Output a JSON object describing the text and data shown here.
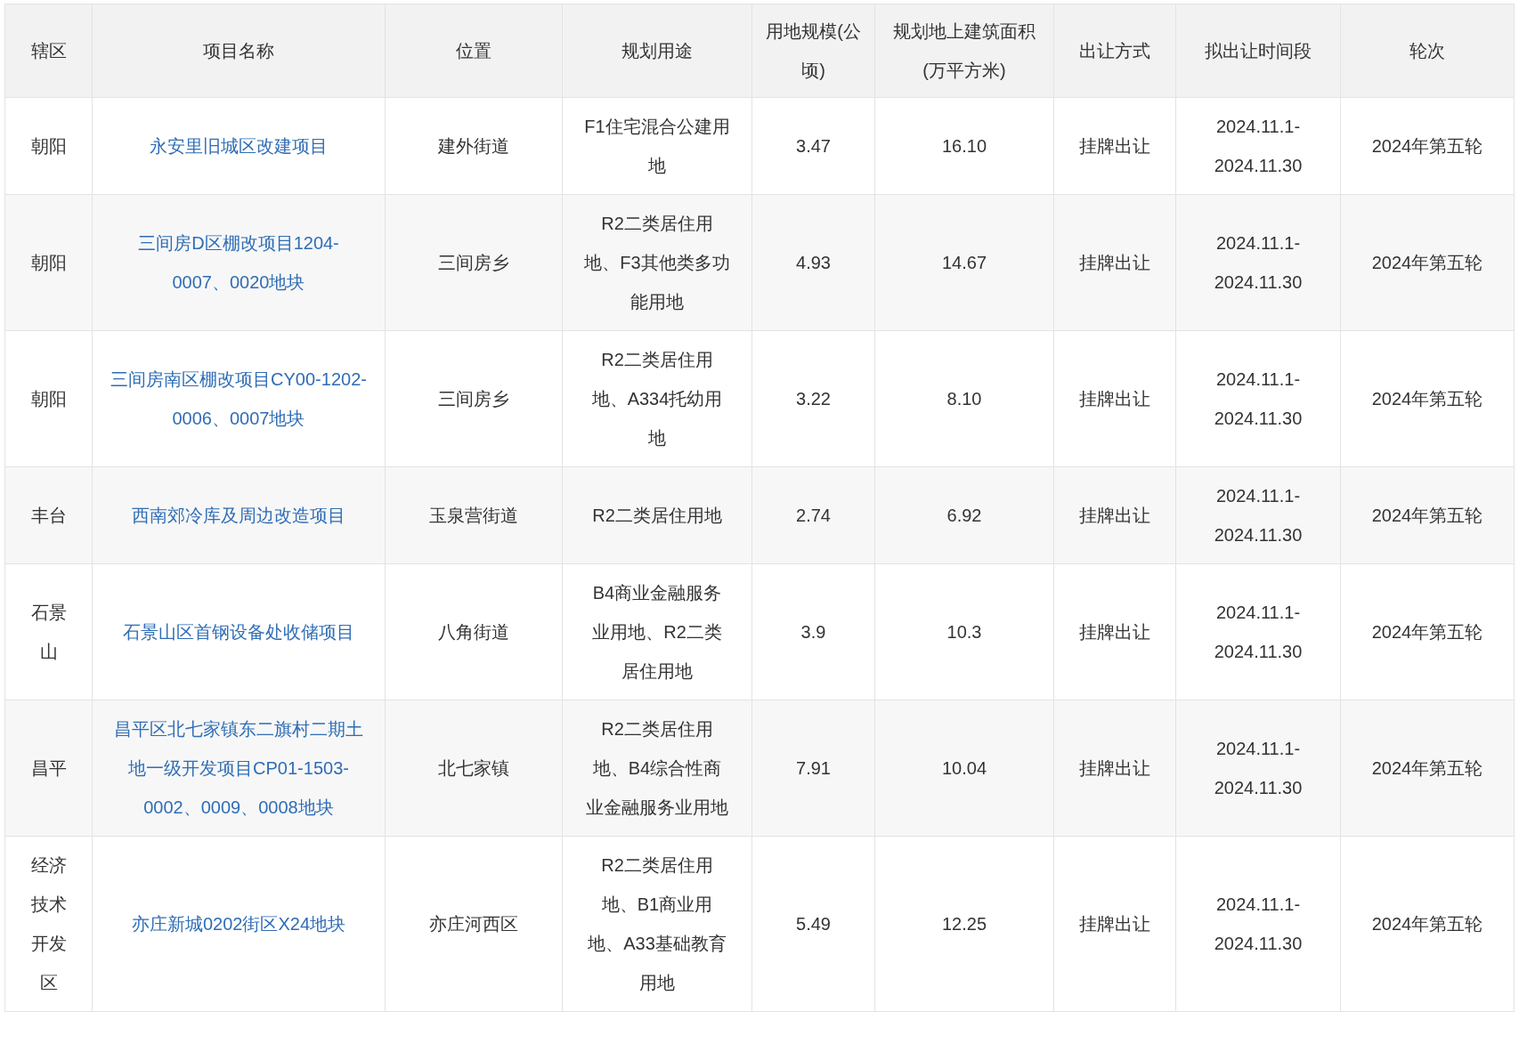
{
  "table": {
    "columns": [
      "辖区",
      "项目名称",
      "位置",
      "规划用途",
      "用地规模(公顷)",
      "规划地上建筑面积(万平方米)",
      "出让方式",
      "拟出让时间段",
      "轮次"
    ],
    "rows": [
      {
        "district": "朝阳",
        "project": "永安里旧城区改建项目",
        "location": "建外街道",
        "use": "F1住宅混合公建用地",
        "area": "3.47",
        "floor_area": "16.10",
        "method": "挂牌出让",
        "period": "2024.11.1-2024.11.30",
        "round": "2024年第五轮"
      },
      {
        "district": "朝阳",
        "project": "三间房D区棚改项目1204-0007、0020地块",
        "location": "三间房乡",
        "use": "R2二类居住用地、F3其他类多功能用地",
        "area": "4.93",
        "floor_area": "14.67",
        "method": "挂牌出让",
        "period": "2024.11.1-2024.11.30",
        "round": "2024年第五轮"
      },
      {
        "district": "朝阳",
        "project": "三间房南区棚改项目CY00-1202-0006、0007地块",
        "location": "三间房乡",
        "use": "R2二类居住用地、A334托幼用地",
        "area": "3.22",
        "floor_area": "8.10",
        "method": "挂牌出让",
        "period": "2024.11.1-2024.11.30",
        "round": "2024年第五轮"
      },
      {
        "district": "丰台",
        "project": "西南郊冷库及周边改造项目",
        "location": "玉泉营街道",
        "use": "R2二类居住用地",
        "area": "2.74",
        "floor_area": "6.92",
        "method": "挂牌出让",
        "period": "2024.11.1-2024.11.30",
        "round": "2024年第五轮"
      },
      {
        "district": "石景山",
        "project": "石景山区首钢设备处收储项目",
        "location": "八角街道",
        "use": "B4商业金融服务业用地、R2二类居住用地",
        "area": "3.9",
        "floor_area": "10.3",
        "method": "挂牌出让",
        "period": "2024.11.1-2024.11.30",
        "round": "2024年第五轮"
      },
      {
        "district": "昌平",
        "project": "昌平区北七家镇东二旗村二期土地一级开发项目CP01-1503-0002、0009、0008地块",
        "location": "北七家镇",
        "use": "R2二类居住用地、B4综合性商业金融服务业用地",
        "area": "7.91",
        "floor_area": "10.04",
        "method": "挂牌出让",
        "period": "2024.11.1-2024.11.30",
        "round": "2024年第五轮"
      },
      {
        "district": "经济技术开发区",
        "project": "亦庄新城0202街区X24地块",
        "location": "亦庄河西区",
        "use": "R2二类居住用地、B1商业用地、A33基础教育用地",
        "area": "5.49",
        "floor_area": "12.25",
        "method": "挂牌出让",
        "period": "2024.11.1-2024.11.30",
        "round": "2024年第五轮"
      }
    ]
  }
}
